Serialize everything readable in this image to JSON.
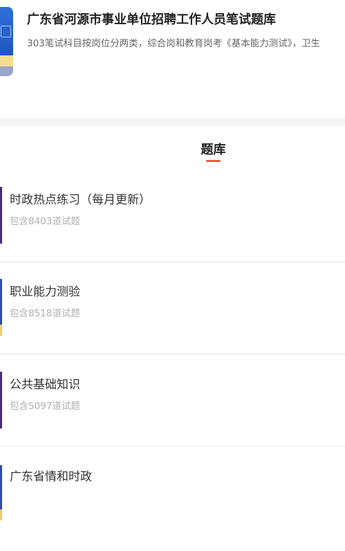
{
  "book": {
    "title": "广东省河源市事业单位招聘工作人员笔试题库",
    "description": "303笔试科目按岗位分两类，综合岗和教育岗考《基本能力测试》，卫生"
  },
  "section": {
    "title": "题库"
  },
  "banks": [
    {
      "name": "时政热点练习（每月更新）",
      "count": "包含8403道试题"
    },
    {
      "name": "职业能力测验",
      "count": "包含8518道试题"
    },
    {
      "name": "公共基础知识",
      "count": "包含5097道试题"
    },
    {
      "name": "广东省情和时政",
      "count": ""
    }
  ],
  "colors": {
    "accent": "#e8603c",
    "cover_blue": "#1f57c2",
    "edge_purple": "#4a2a7a",
    "edge_blue": "#2a4fb0",
    "edge_yellow": "#f2c96b"
  }
}
